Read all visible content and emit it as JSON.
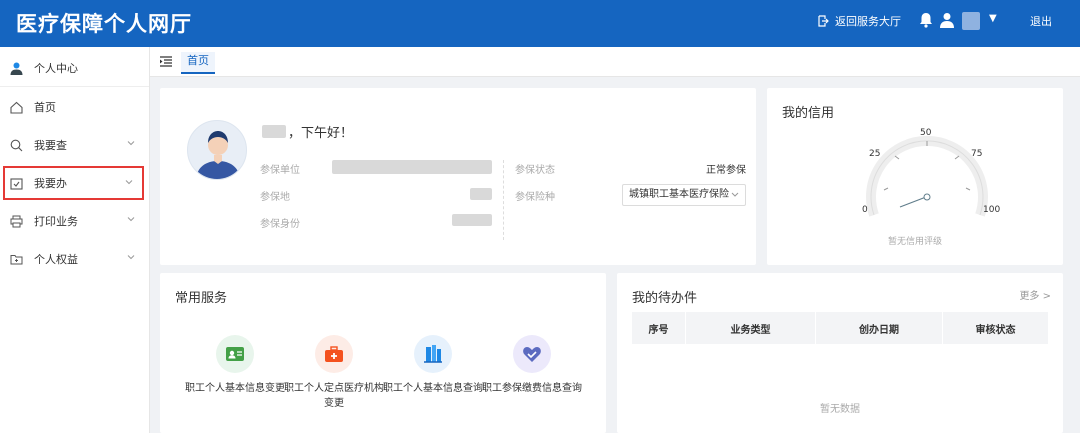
{
  "header": {
    "title": "医疗保障个人网厅",
    "return_label": "返回服务大厅",
    "logout_label": "退出"
  },
  "sidebar": {
    "personal_center": "个人中心",
    "items": [
      {
        "label": "首页",
        "icon": "home-icon",
        "chevron": false
      },
      {
        "label": "我要查",
        "icon": "search-icon",
        "chevron": true
      },
      {
        "label": "我要办",
        "icon": "handle-icon",
        "chevron": true,
        "highlighted": true
      },
      {
        "label": "打印业务",
        "icon": "printer-icon",
        "chevron": true
      },
      {
        "label": "个人权益",
        "icon": "folder-icon",
        "chevron": true
      }
    ]
  },
  "tabs": [
    {
      "label": "首页",
      "active": true
    }
  ],
  "profile": {
    "greeting": "，下午好！",
    "fields": [
      {
        "label": "参保单位"
      },
      {
        "label": "参保地"
      },
      {
        "label": "参保身份"
      }
    ],
    "status_label": "参保状态",
    "status_value": "正常参保",
    "insurance_type_label": "参保险种",
    "insurance_type_value": "城镇职工基本医疗保险"
  },
  "credit": {
    "title": "我的信用",
    "gauge_labels": [
      "0",
      "25",
      "50",
      "75",
      "100"
    ],
    "no_rating": "暂无信用评级"
  },
  "services": {
    "title": "常用服务",
    "items": [
      {
        "label": "职工个人基本信息变更",
        "icon": "id-card-icon",
        "color": "#e8f5ec",
        "icon_color": "#43a047"
      },
      {
        "label": "职工个人定点医疗机构变更",
        "icon": "medical-kit-icon",
        "color": "#fdece6",
        "icon_color": "#f4511e"
      },
      {
        "label": "职工个人基本信息查询",
        "icon": "building-icon",
        "color": "#e6f1fc",
        "icon_color": "#1e88e5"
      },
      {
        "label": "职工参保缴费信息查询",
        "icon": "heart-check-icon",
        "color": "#ece9fb",
        "icon_color": "#5c6bc0"
      }
    ]
  },
  "todo": {
    "title": "我的待办件",
    "more_label": "更多 >",
    "columns": [
      "序号",
      "业务类型",
      "创办日期",
      "审核状态"
    ],
    "empty": "暂无数据"
  }
}
